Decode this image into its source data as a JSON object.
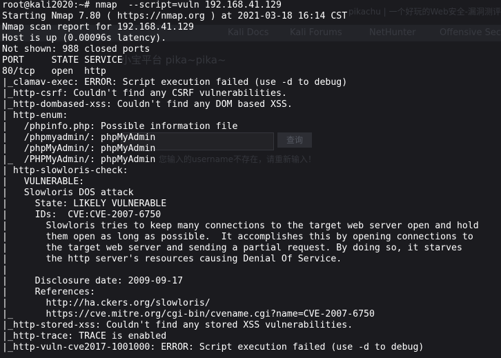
{
  "background_ghost": {
    "tab_text": "pikachu | 一个好玩的Web安全-漏洞测评平台",
    "bookmarks": [
      "Kali Docs",
      "Kali Forums",
      "NetHunter",
      "Offensive Sec"
    ],
    "heading": "小宝平台 pika~pika~",
    "button": "查询",
    "notice": "您输入的username不存在，请重新输入！"
  },
  "terminal": {
    "lines": [
      "root@kali2020:~# nmap  --script=vuln 192.168.41.129",
      "Starting Nmap 7.80 ( https://nmap.org ) at 2021-03-18 16:14 CST",
      "Nmap scan report for 192.168.41.129",
      "Host is up (0.00096s latency).",
      "Not shown: 988 closed ports",
      "PORT     STATE SERVICE",
      "80/tcp   open  http",
      "|_clamav-exec: ERROR: Script execution failed (use -d to debug)",
      "|_http-csrf: Couldn't find any CSRF vulnerabilities.",
      "|_http-dombased-xss: Couldn't find any DOM based XSS.",
      "| http-enum:",
      "|   /phpinfo.php: Possible information file",
      "|   /phpmyadmin/: phpMyAdmin",
      "|   /phpMyAdmin/: phpMyAdmin",
      "|_  /PHPMyAdmin/: phpMyAdmin",
      "| http-slowloris-check:",
      "|   VULNERABLE:",
      "|   Slowloris DOS attack",
      "|     State: LIKELY VULNERABLE",
      "|     IDs:  CVE:CVE-2007-6750",
      "|       Slowloris tries to keep many connections to the target web server open and hold",
      "|       them open as long as possible.  It accomplishes this by opening connections to",
      "|       the target web server and sending a partial request. By doing so, it starves",
      "|       the http server's resources causing Denial Of Service.",
      "|",
      "|     Disclosure date: 2009-09-17",
      "|     References:",
      "|       http://ha.ckers.org/slowloris/",
      "|_      https://cve.mitre.org/cgi-bin/cvename.cgi?name=CVE-2007-6750",
      "|_http-stored-xss: Couldn't find any stored XSS vulnerabilities.",
      "|_http-trace: TRACE is enabled",
      "|_http-vuln-cve2017-1001000: ERROR: Script execution failed (use -d to debug)"
    ]
  },
  "colors": {
    "background": "#1b1b1f",
    "text": "#ffffff"
  }
}
